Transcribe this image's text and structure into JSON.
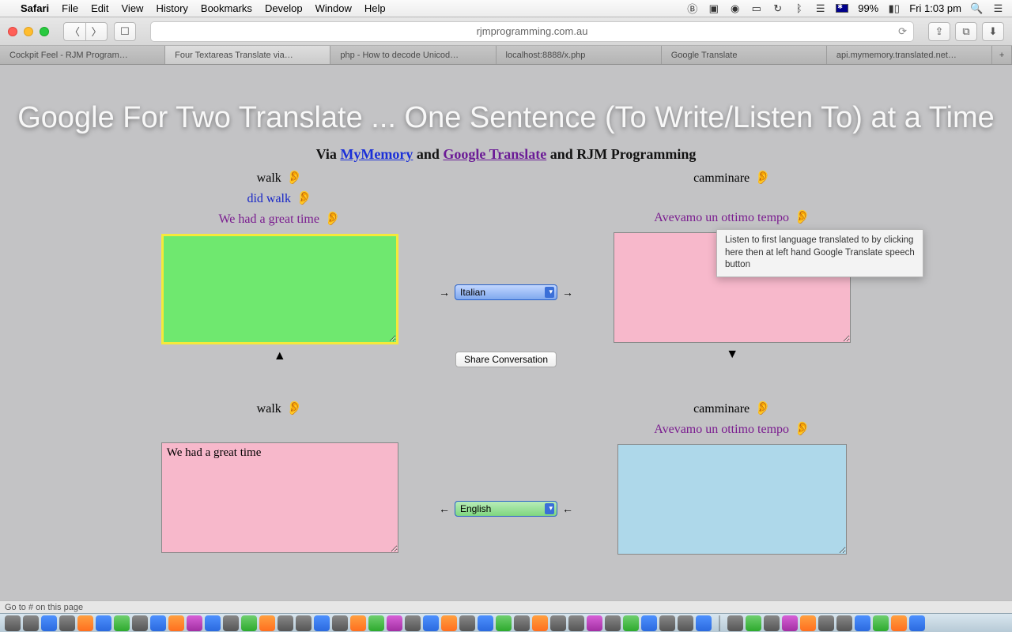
{
  "menubar": {
    "app": "Safari",
    "items": [
      "File",
      "Edit",
      "View",
      "History",
      "Bookmarks",
      "Develop",
      "Window",
      "Help"
    ],
    "battery": "99%",
    "clock": "Fri 1:03 pm"
  },
  "toolbar": {
    "url": "rjmprogramming.com.au"
  },
  "tabs": [
    "Cockpit Feel - RJM Program…",
    "Four Textareas Translate via…",
    "php - How to decode Unicod…",
    "localhost:8888/x.php",
    "Google Translate",
    "api.mymemory.translated.net…"
  ],
  "active_tab_index": 1,
  "page": {
    "title": "Google For Two Translate ... One Sentence (To Write/Listen To) at a Time",
    "subtitle_prefix": "Via ",
    "link_mymemory": "MyMemory",
    "mid1": " and ",
    "link_gtrans": "Google Translate",
    "mid2": " and RJM Programming",
    "top_left_labels": {
      "l1": "walk",
      "l2": "did walk",
      "l3": "We had a great time"
    },
    "top_right_labels": {
      "l1": "camminare",
      "l3": "Avevamo un ottimo tempo"
    },
    "bottom_left_labels": {
      "l1": "walk"
    },
    "bottom_right_labels": {
      "l1": "camminare",
      "l3": "Avevamo un ottimo tempo"
    },
    "textarea_bl_value": "We had a great time",
    "lang_top": "Italian",
    "lang_bottom": "English",
    "share_btn": "Share Conversation",
    "tooltip": "Listen to first language translated to by clicking here then at left hand Google Translate speech button",
    "tri_up": "▲",
    "tri_down": "▼"
  },
  "status": "Go to # on this page"
}
